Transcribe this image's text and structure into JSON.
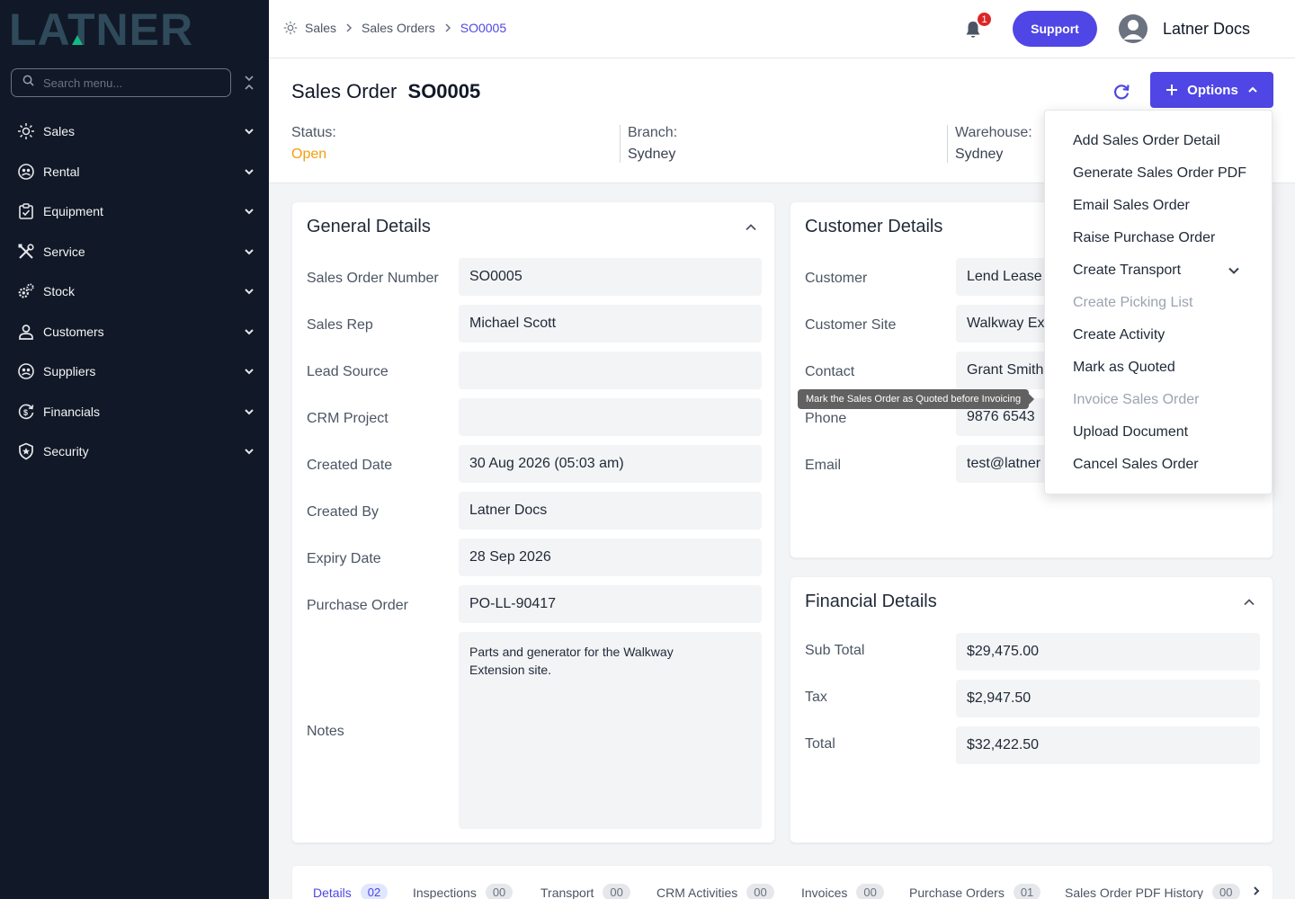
{
  "brand": {
    "logo_text": "LATNER"
  },
  "sidebar": {
    "search_placeholder": "Search menu...",
    "items": [
      {
        "label": "Sales",
        "icon": "sun-icon"
      },
      {
        "label": "Rental",
        "icon": "users-circle-icon"
      },
      {
        "label": "Equipment",
        "icon": "clipboard-icon"
      },
      {
        "label": "Service",
        "icon": "tools-icon"
      },
      {
        "label": "Stock",
        "icon": "gears-icon"
      },
      {
        "label": "Customers",
        "icon": "user-icon"
      },
      {
        "label": "Suppliers",
        "icon": "users-circle-icon"
      },
      {
        "label": "Financials",
        "icon": "dollar-cycle-icon"
      },
      {
        "label": "Security",
        "icon": "shield-icon"
      }
    ]
  },
  "header": {
    "breadcrumbs": [
      "Sales",
      "Sales Orders",
      "SO0005"
    ],
    "notification_count": "1",
    "support_label": "Support",
    "user_name": "Latner Docs"
  },
  "page": {
    "title_prefix": "Sales Order",
    "title_id": "SO0005",
    "options_label": "Options",
    "status_label": "Status:",
    "status_value": "Open",
    "branch_label": "Branch:",
    "branch_value": "Sydney",
    "warehouse_label": "Warehouse:",
    "warehouse_value": "Sydney"
  },
  "general": {
    "title": "General Details",
    "rows": [
      {
        "label": "Sales Order Number",
        "value": "SO0005"
      },
      {
        "label": "Sales Rep",
        "value": "Michael Scott"
      },
      {
        "label": "Lead Source",
        "value": ""
      },
      {
        "label": "CRM Project",
        "value": ""
      },
      {
        "label": "Created Date",
        "value": "30 Aug 2026 (05:03 am)"
      },
      {
        "label": "Created By",
        "value": "Latner Docs"
      },
      {
        "label": "Expiry Date",
        "value": "28 Sep 2026"
      },
      {
        "label": "Purchase Order",
        "value": "PO-LL-90417"
      }
    ],
    "notes_label": "Notes",
    "notes_value": "Parts and generator for the Walkway Extension site."
  },
  "customer": {
    "title": "Customer Details",
    "rows": [
      {
        "label": "Customer",
        "value": "Lend Lease"
      },
      {
        "label": "Customer Site",
        "value": "Walkway Ex"
      },
      {
        "label": "Contact",
        "value": "Grant Smith"
      },
      {
        "label": "Phone",
        "value": "9876 6543"
      },
      {
        "label": "Email",
        "value": "test@latner"
      }
    ]
  },
  "financial": {
    "title": "Financial Details",
    "rows": [
      {
        "label": "Sub Total",
        "value": "$29,475.00"
      },
      {
        "label": "Tax",
        "value": "$2,947.50"
      },
      {
        "label": "Total",
        "value": "$32,422.50"
      }
    ]
  },
  "options_menu": [
    {
      "label": "Add Sales Order Detail",
      "disabled": false
    },
    {
      "label": "Generate Sales Order PDF",
      "disabled": false
    },
    {
      "label": "Email Sales Order",
      "disabled": false
    },
    {
      "label": "Raise Purchase Order",
      "disabled": false
    },
    {
      "label": "Create Transport",
      "disabled": false
    },
    {
      "label": "Create Picking List",
      "disabled": true
    },
    {
      "label": "Create Activity",
      "disabled": false
    },
    {
      "label": "Mark as Quoted",
      "disabled": false
    },
    {
      "label": "Invoice Sales Order",
      "disabled": true
    },
    {
      "label": "Upload Document",
      "disabled": false
    },
    {
      "label": "Cancel Sales Order",
      "disabled": false
    }
  ],
  "tooltip": "Mark the Sales Order as Quoted before Invoicing",
  "tabs": [
    {
      "label": "Details",
      "count": "02"
    },
    {
      "label": "Inspections",
      "count": "00"
    },
    {
      "label": "Transport",
      "count": "00"
    },
    {
      "label": "CRM Activities",
      "count": "00"
    },
    {
      "label": "Invoices",
      "count": "00"
    },
    {
      "label": "Purchase Orders",
      "count": "01"
    },
    {
      "label": "Sales Order PDF History",
      "count": "00"
    }
  ],
  "colors": {
    "sidebar_bg": "#111827",
    "accent": "#4f46e5",
    "status_open": "#f59e0b",
    "logo": "#2f4a5a",
    "logo_accent": "#12b886"
  }
}
